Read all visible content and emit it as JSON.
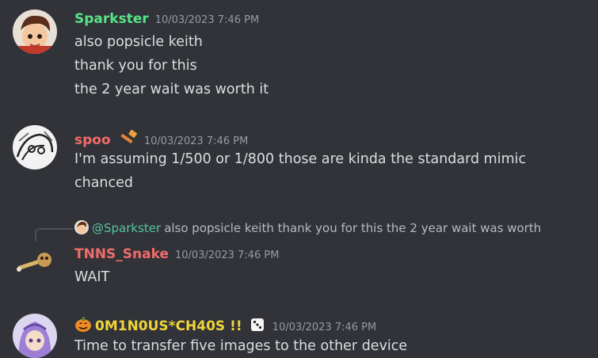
{
  "messages": [
    {
      "author": "Sparkster",
      "author_color": "#57e389",
      "timestamp": "10/03/2023 7:46 PM",
      "lines": [
        "also popsicle keith",
        "thank you for this",
        "the 2 year wait was worth it"
      ]
    },
    {
      "author": "spoo",
      "author_color": "#f26b6b",
      "badge_icon": "hammer-icon",
      "timestamp": "10/03/2023 7:46 PM",
      "lines": [
        "I'm assuming 1/500 or 1/800 those are kinda the standard mimic",
        "chanced"
      ]
    },
    {
      "reply": {
        "mention": "@Sparkster",
        "text": "also popsicle keith thank you for this the 2 year wait was worth"
      },
      "author": "TNNS_Snake",
      "author_color": "#f26b6b",
      "timestamp": "10/03/2023 7:46 PM",
      "lines": [
        "WAIT"
      ]
    },
    {
      "author": "0M1N0US*CH40S !!",
      "author_color": "#f0d43a",
      "prefix_icon": "pumpkin-icon",
      "badge_icon": "dice-icon",
      "timestamp": "10/03/2023 7:46 PM",
      "lines": [
        "Time to transfer five images to the other device"
      ]
    }
  ]
}
